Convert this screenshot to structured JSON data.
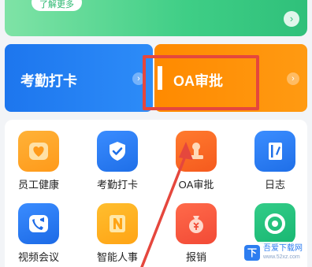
{
  "banner": {
    "button_label": "了解更多",
    "arrow": "›"
  },
  "cards": {
    "attendance": {
      "label": "考勤打卡",
      "arrow": "›"
    },
    "oa": {
      "label": "OA审批",
      "arrow": "›"
    }
  },
  "apps": [
    {
      "label": "员工健康",
      "icon": "heart-icon"
    },
    {
      "label": "考勤打卡",
      "icon": "shield-check-icon"
    },
    {
      "label": "OA审批",
      "icon": "stamp-icon"
    },
    {
      "label": "日志",
      "icon": "notebook-icon"
    },
    {
      "label": "视频会议",
      "icon": "video-phone-icon"
    },
    {
      "label": "智能人事",
      "icon": "n-letter-icon"
    },
    {
      "label": "报销",
      "icon": "money-bag-icon"
    },
    {
      "label": "",
      "icon": "circle-icon"
    }
  ],
  "watermark": {
    "brand": "吾爱下载网",
    "url": "www.52xz.com"
  },
  "colors": {
    "banner_green": "#3fce86",
    "attendance_blue": "#1d76ee",
    "oa_orange": "#ff8a00",
    "annotation_red": "#e5473d"
  }
}
